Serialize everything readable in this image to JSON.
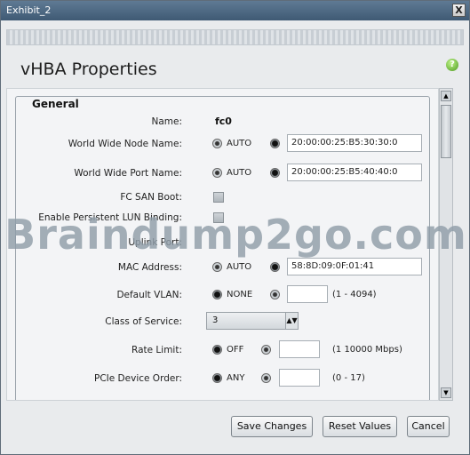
{
  "window": {
    "title": "Exhibit_2",
    "close_label": "X"
  },
  "page": {
    "title": "vHBA Properties",
    "help_icon": "?"
  },
  "general": {
    "legend": "General",
    "name": {
      "label": "Name:",
      "value": "fc0"
    },
    "wwnn": {
      "label": "World Wide Node Name:",
      "auto_label": "AUTO",
      "value": "20:00:00:25:B5:30:30:0"
    },
    "wwpn": {
      "label": "World Wide Port Name:",
      "auto_label": "AUTO",
      "value": "20:00:00:25:B5:40:40:0"
    },
    "fc_san_boot": {
      "label": "FC SAN Boot:"
    },
    "persistent_lun": {
      "label": "Enable Persistent LUN Binding:"
    },
    "uplink_port": {
      "label": "Uplink Port:"
    },
    "mac": {
      "label": "MAC Address:",
      "auto_label": "AUTO",
      "value": "58:8D:09:0F:01:41"
    },
    "default_vlan": {
      "label": "Default VLAN:",
      "none_label": "NONE",
      "value": "",
      "range": "(1 - 4094)"
    },
    "class_of_service": {
      "label": "Class of Service:",
      "selected": "3"
    },
    "rate_limit": {
      "label": "Rate Limit:",
      "off_label": "OFF",
      "value": "",
      "range": "(1  10000 Mbps)"
    },
    "pcie_order": {
      "label": "PCIe Device Order:",
      "any_label": "ANY",
      "value": "",
      "range": "(0 - 17)"
    }
  },
  "watermark": "Braindump2go.com",
  "buttons": {
    "save": "Save Changes",
    "reset": "Reset Values",
    "cancel": "Cancel"
  }
}
